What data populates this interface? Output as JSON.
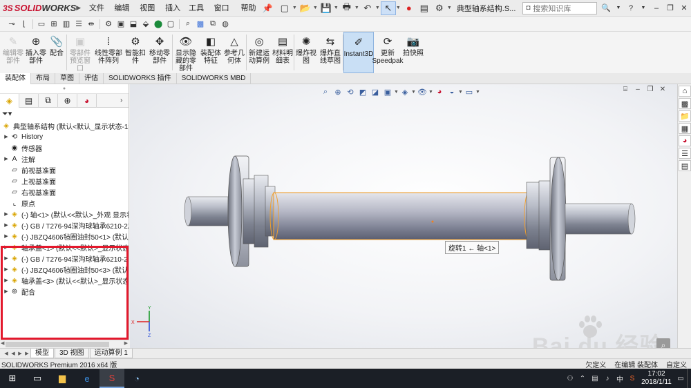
{
  "app": {
    "logo_prefix": "3S",
    "logo_solid": "SOLID",
    "logo_works": "WORKS",
    "doc_title": "典型轴系结构.S...",
    "menus": [
      "文件(F)",
      "编辑(E)",
      "视图(V)",
      "插入(I)",
      "工具(T)",
      "窗口(W)",
      "帮助(H)"
    ],
    "search_placeholder": "搜索知识库"
  },
  "ribbon": {
    "buttons": [
      {
        "label": "编辑零\n部件",
        "icon": "edit-component-icon",
        "glyph": "✎",
        "disabled": true
      },
      {
        "label": "插入零\n部件",
        "icon": "insert-component-icon",
        "glyph": "⊕",
        "disabled": false
      },
      {
        "label": "配合",
        "icon": "mate-icon",
        "glyph": "📎",
        "disabled": false
      },
      {
        "label": "零部件\n预览窗\n口",
        "icon": "component-preview-icon",
        "glyph": "▣",
        "disabled": true
      },
      {
        "label": "线性零部\n件阵列",
        "icon": "linear-pattern-icon",
        "glyph": "⁞",
        "disabled": false
      },
      {
        "label": "智能扣\n件",
        "icon": "smart-fastener-icon",
        "glyph": "⚙",
        "disabled": false
      },
      {
        "label": "移动零\n部件",
        "icon": "move-component-icon",
        "glyph": "✥",
        "disabled": false
      },
      {
        "label": "显示隐\n藏的零\n部件",
        "icon": "show-hidden-icon",
        "glyph": "👁",
        "disabled": false
      },
      {
        "label": "装配体\n特征",
        "icon": "assembly-feature-icon",
        "glyph": "◧",
        "disabled": false
      },
      {
        "label": "参考几\n何体",
        "icon": "reference-geometry-icon",
        "glyph": "△",
        "disabled": false
      },
      {
        "label": "新建运\n动算例",
        "icon": "motion-study-icon",
        "glyph": "◎",
        "disabled": false
      },
      {
        "label": "材料明\n细表",
        "icon": "bom-icon",
        "glyph": "▤",
        "disabled": false
      },
      {
        "label": "爆炸视\n图",
        "icon": "exploded-view-icon",
        "glyph": "✺",
        "disabled": false
      },
      {
        "label": "爆炸直\n线草图",
        "icon": "explode-line-icon",
        "glyph": "⇆",
        "disabled": false
      },
      {
        "label": "Instant3D",
        "icon": "instant3d-icon",
        "glyph": "✐",
        "disabled": false,
        "active": true
      },
      {
        "label": "更新\nSpeedpak",
        "icon": "speedpak-icon",
        "glyph": "⟳",
        "disabled": false
      },
      {
        "label": "拍快照",
        "icon": "snapshot-icon",
        "glyph": "📷",
        "disabled": false
      }
    ]
  },
  "tabs": [
    "装配体",
    "布局",
    "草图",
    "评估",
    "SOLIDWORKS 插件",
    "SOLIDWORKS MBD"
  ],
  "tree": {
    "root": "典型轴系结构 (默认<默认_显示状态-1>)",
    "nodes": [
      {
        "label": "History",
        "icon": "history-icon",
        "glyph": "⟲",
        "exp": true
      },
      {
        "label": "传感器",
        "icon": "sensor-icon",
        "glyph": "◉",
        "exp": false
      },
      {
        "label": "注解",
        "icon": "annotation-icon",
        "glyph": "A",
        "exp": true
      },
      {
        "label": "前视基准面",
        "icon": "plane-icon",
        "glyph": "▱",
        "exp": false
      },
      {
        "label": "上视基准面",
        "icon": "plane-icon",
        "glyph": "▱",
        "exp": false
      },
      {
        "label": "右视基准面",
        "icon": "plane-icon",
        "glyph": "▱",
        "exp": false
      },
      {
        "label": "原点",
        "icon": "origin-icon",
        "glyph": "⌞",
        "exp": false
      },
      {
        "label": "(-) 轴<1> (默认<<默认>_外观 显示状",
        "icon": "part-icon",
        "glyph": "◈",
        "exp": true,
        "part": true
      },
      {
        "label": "(-) GB / T276-94深沟球轴承6210-2Z",
        "icon": "part-icon",
        "glyph": "◈",
        "exp": true,
        "part": true
      },
      {
        "label": "(-) JBZQ4606毡圈油封50<1> (默认<",
        "icon": "part-icon",
        "glyph": "◈",
        "exp": true,
        "part": true
      },
      {
        "label": "轴承盖<1> (默认<<默认>_显示状态 1",
        "icon": "part-icon",
        "glyph": "◈",
        "exp": true,
        "part": true
      },
      {
        "label": "(-) GB / T276-94深沟球轴承6210-2Z",
        "icon": "part-icon",
        "glyph": "◈",
        "exp": true,
        "part": true
      },
      {
        "label": "(-) JBZQ4606毡圈油封50<3> (默认<",
        "icon": "part-icon",
        "glyph": "◈",
        "exp": true,
        "part": true
      },
      {
        "label": "轴承盖<3> (默认<<默认>_显示状态 1",
        "icon": "part-icon",
        "glyph": "◈",
        "exp": true,
        "part": true
      },
      {
        "label": "配合",
        "icon": "mates-folder-icon",
        "glyph": "⊚",
        "exp": true
      }
    ]
  },
  "model_tabs": [
    "模型",
    "3D 视图",
    "运动算例 1"
  ],
  "viewport": {
    "tooltip": "旋转1 ← 轴<1>",
    "axis_labels": {
      "x": "X",
      "y": "Y",
      "z": "Z"
    }
  },
  "status": {
    "left": "SOLIDWORKS Premium 2016 x64 版",
    "right": [
      "欠定义",
      "在编辑 装配体",
      "自定义"
    ]
  },
  "watermark": {
    "brand": "Bai du 经验",
    "sub": "jingyan.baidu.com"
  },
  "taskbar": {
    "time": "17:02",
    "date": "2018/1/11",
    "ime": "中"
  }
}
